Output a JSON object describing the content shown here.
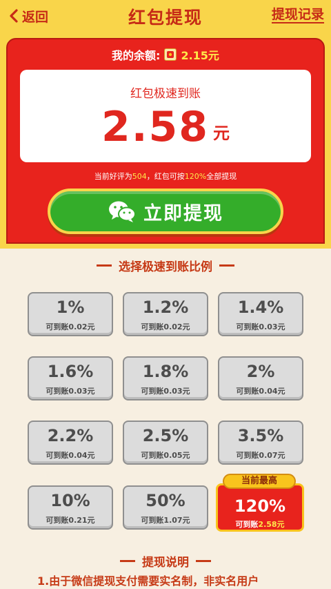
{
  "header": {
    "back_label": "返回",
    "title": "红包提现",
    "record_label": "提现记录"
  },
  "balance": {
    "label": "我的余额:",
    "amount": "2.15元"
  },
  "express": {
    "label": "红包极速到账",
    "amount": "2.58",
    "unit": "元"
  },
  "rating_note": {
    "prefix": "当前好评为",
    "score": "504",
    "middle": "，红包可按",
    "ratio": "120%",
    "suffix": "全部提现"
  },
  "cta_label": "立即提现",
  "ratio_section_title": "选择极速到账比例",
  "options": [
    {
      "pct": "1%",
      "sub": "可到账0.02元"
    },
    {
      "pct": "1.2%",
      "sub": "可到账0.02元"
    },
    {
      "pct": "1.4%",
      "sub": "可到账0.03元"
    },
    {
      "pct": "1.6%",
      "sub": "可到账0.03元"
    },
    {
      "pct": "1.8%",
      "sub": "可到账0.03元"
    },
    {
      "pct": "2%",
      "sub": "可到账0.04元"
    },
    {
      "pct": "2.2%",
      "sub": "可到账0.04元"
    },
    {
      "pct": "2.5%",
      "sub": "可到账0.05元"
    },
    {
      "pct": "3.5%",
      "sub": "可到账0.07元"
    },
    {
      "pct": "10%",
      "sub": "可到账0.21元"
    },
    {
      "pct": "50%",
      "sub": "可到账1.07元"
    }
  ],
  "selected_option": {
    "badge": "当前最高",
    "pct": "120%",
    "sub_prefix": "可到账",
    "sub_amount": "2.58元"
  },
  "desc_section_title": "提现说明",
  "desc_line_1": "1.由于微信提现支付需要实名制，非实名用户",
  "colors": {
    "primary_red": "#e8231d",
    "accent_yellow": "#f9d54a",
    "cta_green": "#34ad2a"
  }
}
